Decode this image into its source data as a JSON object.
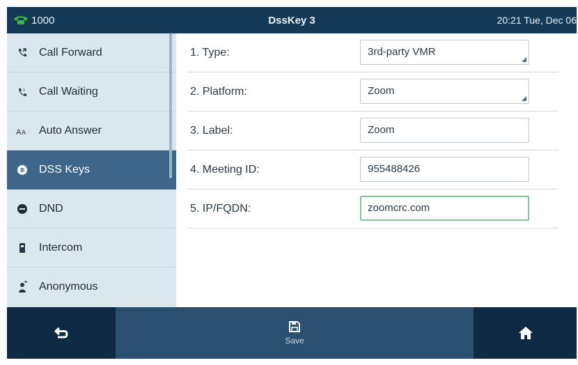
{
  "status_bar": {
    "line_number": "1000",
    "title": "DssKey 3",
    "clock": "20:21 Tue, Dec 06"
  },
  "sidebar": {
    "items": [
      {
        "label": "Call Forward",
        "icon": "call-forward-icon"
      },
      {
        "label": "Call Waiting",
        "icon": "call-waiting-icon"
      },
      {
        "label": "Auto Answer",
        "icon": "auto-answer-icon"
      },
      {
        "label": "DSS Keys",
        "icon": "dss-keys-icon",
        "active": true
      },
      {
        "label": "DND",
        "icon": "dnd-icon"
      },
      {
        "label": "Intercom",
        "icon": "intercom-icon"
      },
      {
        "label": "Anonymous",
        "icon": "anonymous-icon"
      }
    ]
  },
  "form": {
    "fields": [
      {
        "label": "1. Type:",
        "value": "3rd-party VMR",
        "kind": "select"
      },
      {
        "label": "2. Platform:",
        "value": "Zoom",
        "kind": "select"
      },
      {
        "label": "3. Label:",
        "value": "Zoom",
        "kind": "text"
      },
      {
        "label": "4. Meeting ID:",
        "value": "955488426",
        "kind": "text"
      },
      {
        "label": "5. IP/FQDN:",
        "value": "zoomcrc.com",
        "kind": "text",
        "focused": true
      }
    ]
  },
  "softkeys": {
    "back_icon": "back-arrow-icon",
    "save_label": "Save",
    "save_icon": "save-icon",
    "home_icon": "home-icon"
  },
  "colors": {
    "status_bar": "#143a58",
    "sidebar_bg": "#dbe7ee",
    "sidebar_active": "#3d6689",
    "softkey_bar": "#0f2b43",
    "line_indicator": "#3bb54a",
    "focus_border": "#7fc59c"
  }
}
